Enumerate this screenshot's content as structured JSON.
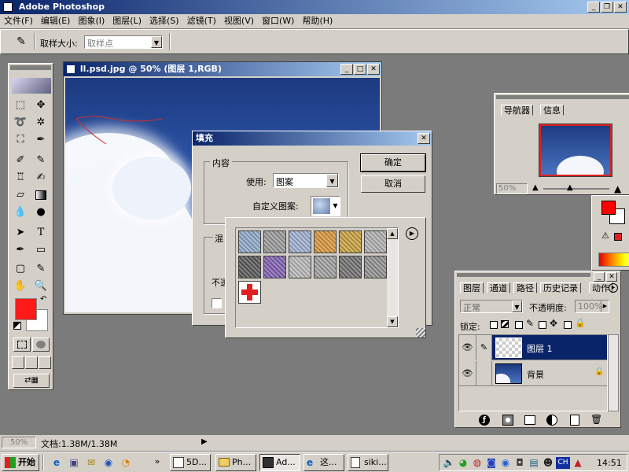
{
  "app_title": "Adobe Photoshop",
  "menu": [
    "文件(F)",
    "编辑(E)",
    "图象(I)",
    "图层(L)",
    "选择(S)",
    "滤镜(T)",
    "视图(V)",
    "窗口(W)",
    "帮助(H)"
  ],
  "options_bar": {
    "sample_size_label": "取样大小:",
    "sample_size_value": "取样点"
  },
  "document": {
    "title": "ll.psd.jpg @ 50% (图层 1,RGB)"
  },
  "fill_dialog": {
    "title": "填充",
    "content_group": "内容",
    "use_label": "使用:",
    "use_value": "图案",
    "custom_pattern_label": "自定义图案:",
    "ok": "确定",
    "cancel": "取消",
    "blend_group_partial": "混",
    "opacity_partial": "不透"
  },
  "pattern_picker": {
    "colors": [
      "#8ea8c8",
      "#9a9a9a",
      "#9eb0d0",
      "#d8963a",
      "#c8a040",
      "#b0b0b0",
      "#585858",
      "#8060b0",
      "#b8b8b8",
      "#a0a0a0",
      "#707070",
      "#909090",
      "#e02020"
    ]
  },
  "navigator": {
    "tabs": [
      "导航器",
      "信息"
    ],
    "zoom": "50%"
  },
  "layers_panel": {
    "tabs": [
      "图层",
      "通道",
      "路径",
      "历史记录",
      "动作"
    ],
    "blend_mode": "正常",
    "opacity_label": "不透明度:",
    "opacity_value": "100%",
    "lock_label": "锁定:",
    "layers": [
      {
        "name": "图层 1",
        "selected": true
      },
      {
        "name": "背景",
        "selected": false
      }
    ]
  },
  "status_bar": {
    "zoom": "50%",
    "doc_size": "文档:1.38M/1.38M"
  },
  "colors": {
    "foreground": "#ff0000",
    "background": "#ffffff",
    "title_active": "#0a246a"
  },
  "taskbar": {
    "start": "开始",
    "items": [
      "5D...",
      "Ph...",
      "Ad...",
      "这...",
      "siki..."
    ],
    "clock": "14:51",
    "lang": "CH"
  }
}
